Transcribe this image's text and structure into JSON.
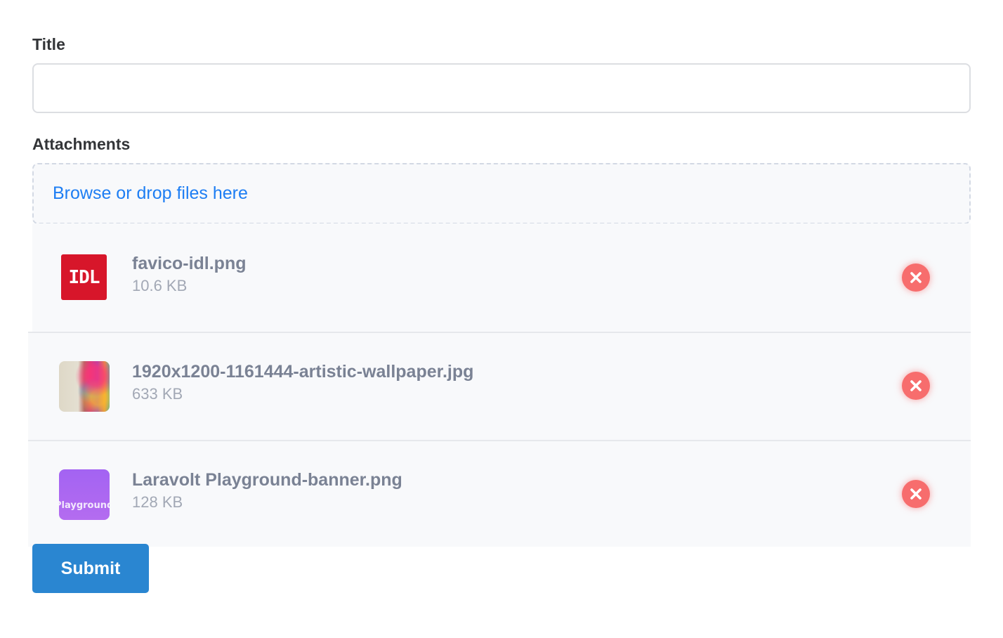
{
  "form": {
    "title_label": "Title",
    "title_value": "",
    "title_placeholder": "",
    "attachments_label": "Attachments",
    "dropzone_text": "Browse or drop files here",
    "submit_label": "Submit"
  },
  "files": [
    {
      "name": "favico-idl.png",
      "size": "10.6 KB",
      "thumb_text": "IDL"
    },
    {
      "name": "1920x1200-1161444-artistic-wallpaper.jpg",
      "size": "633 KB"
    },
    {
      "name": "Laravolt Playground-banner.png",
      "size": "128 KB",
      "thumb_text": "Playground"
    }
  ],
  "colors": {
    "link": "#1e7ef3",
    "remove": "#f76d6d",
    "submit": "#2a86d1",
    "idl_red": "#d7162a",
    "purple_thumb": "#a363f2"
  },
  "icons": {
    "remove": "close-icon"
  }
}
